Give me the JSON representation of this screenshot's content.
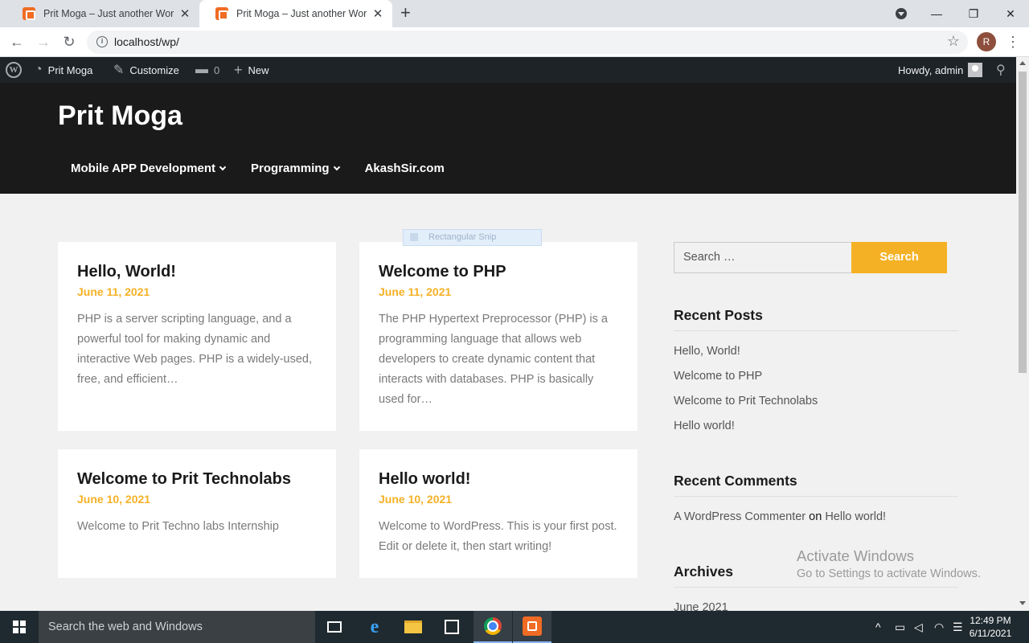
{
  "browser": {
    "tabs": [
      {
        "title": "Prit Moga – Just another WordPress site",
        "active": false
      },
      {
        "title": "Prit Moga – Just another WordPress site",
        "active": true
      }
    ],
    "url": "localhost/wp/",
    "profile_initial": "R"
  },
  "adminbar": {
    "site": "Prit Moga",
    "customize": "Customize",
    "comments_count": "0",
    "new": "New",
    "howdy": "Howdy, admin"
  },
  "site": {
    "title": "Prit Moga",
    "menu": [
      {
        "label": "Mobile APP Development",
        "has_dropdown": true
      },
      {
        "label": "Programming",
        "has_dropdown": true
      },
      {
        "label": "AkashSir.com",
        "has_dropdown": false
      }
    ]
  },
  "snip_overlay": "Rectangular Snip",
  "posts": [
    {
      "title": "Hello, World!",
      "date": "June 11, 2021",
      "excerpt": "PHP is a server scripting language, and a powerful tool for making dynamic and interactive Web pages. PHP is a widely-used, free, and efficient…"
    },
    {
      "title": "Welcome to PHP",
      "date": "June 11, 2021",
      "excerpt": "The PHP Hypertext Preprocessor (PHP) is a programming language that allows web developers to create dynamic content that interacts with databases. PHP is basically used for…"
    },
    {
      "title": "Welcome to Prit Technolabs",
      "date": "June 10, 2021",
      "excerpt": "Welcome to Prit Techno labs Internship"
    },
    {
      "title": "Hello world!",
      "date": "June 10, 2021",
      "excerpt": "Welcome to WordPress. This is your first post. Edit or delete it, then start writing!"
    }
  ],
  "sidebar": {
    "search_placeholder": "Search …",
    "search_button": "Search",
    "recent_posts_title": "Recent Posts",
    "recent_posts": [
      "Hello, World!",
      "Welcome to PHP",
      "Welcome to Prit Technolabs",
      "Hello world!"
    ],
    "recent_comments_title": "Recent Comments",
    "comment_author": "A WordPress Commenter",
    "comment_on": "on",
    "comment_post": "Hello world!",
    "archives_title": "Archives",
    "archives": [
      "June 2021"
    ]
  },
  "watermark": {
    "title": "Activate Windows",
    "subtitle": "Go to Settings to activate Windows."
  },
  "taskbar": {
    "search_placeholder": "Search the web and Windows",
    "time": "12:49 PM",
    "date": "6/11/2021"
  },
  "colors": {
    "accent": "#f5b125",
    "header_bg": "#1a1a1a",
    "adminbar_bg": "#1d2327"
  }
}
